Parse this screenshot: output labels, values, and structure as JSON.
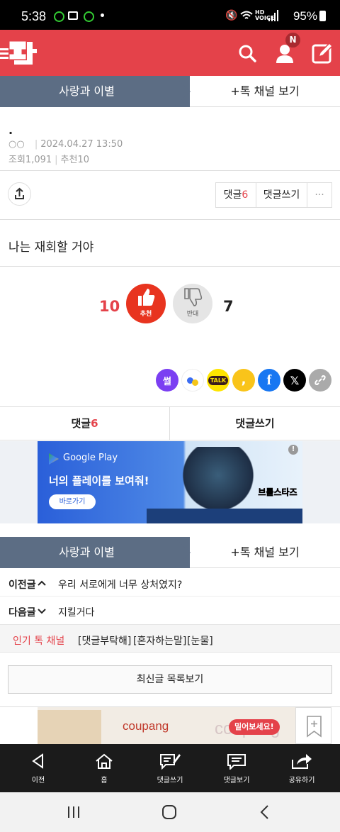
{
  "status": {
    "time": "5:38",
    "battery": "95%"
  },
  "channel": {
    "name": "사랑과 이별",
    "more": "+톡 채널 보기"
  },
  "post": {
    "title": ".",
    "author": "○○",
    "date": "2024.04.27 13:50",
    "views": "조회1,091",
    "recommend": "추천10",
    "body": "나는 재회할 거야"
  },
  "actions": {
    "comment_label": "댓글",
    "comment_count": "6",
    "write_comment": "댓글쓰기",
    "more": "···"
  },
  "vote": {
    "up_count": "10",
    "up_label": "추천",
    "down_label": "반대",
    "down_count": "7"
  },
  "share_icons": {
    "sseol": "썰",
    "kakao_talk": "TALK"
  },
  "tabs": {
    "comments_label": "댓글",
    "comments_count": "6",
    "write": "댓글쓰기"
  },
  "ad1": {
    "store": "Google Play",
    "headline": "너의 플레이를 보여줘!",
    "cta": "바로가기",
    "game_title": "브롤스타즈"
  },
  "nav_posts": {
    "prev_label": "이전글",
    "prev_title": "우리 서로에게 너무 상처였지?",
    "next_label": "다음글",
    "next_title": "지킬거다"
  },
  "popular": {
    "label": "인기 톡 채널",
    "items": [
      "[댓글부탁해]",
      "[혼자하는말]",
      "[눈물]"
    ]
  },
  "latest_button": "최신글 목록보기",
  "ad2": {
    "brand": "coupang",
    "badge": "밀어보세요!"
  },
  "bottom_nav": [
    {
      "label": "이전"
    },
    {
      "label": "홈"
    },
    {
      "label": "댓글쓰기"
    },
    {
      "label": "댓글보기"
    },
    {
      "label": "공유하기"
    }
  ],
  "header": {
    "notification_badge": "N"
  },
  "colors": {
    "brand": "#e4424a",
    "channel_bar": "#5c6d84"
  }
}
